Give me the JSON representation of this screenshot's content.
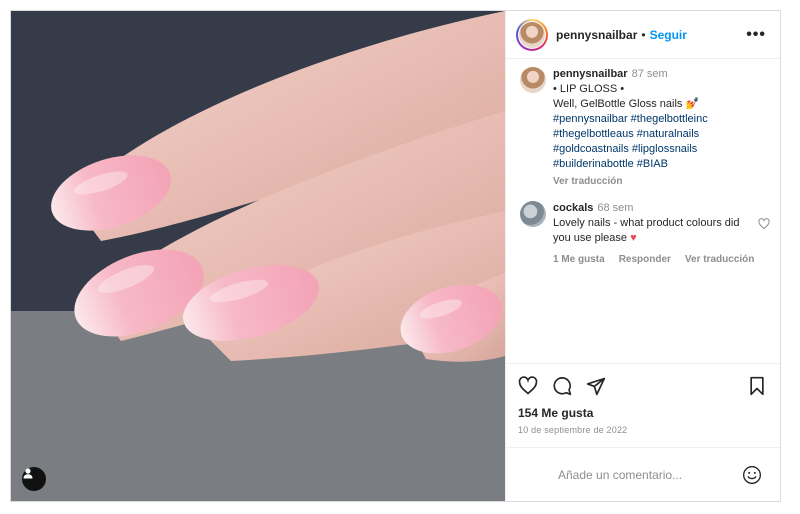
{
  "post": {
    "author": {
      "username": "pennysnailbar",
      "separator": "•",
      "follow_label": "Seguir",
      "more_icon": "more-horizontal-icon"
    },
    "caption": {
      "username": "pennysnailbar",
      "time": "87 sem",
      "line1": "• LIP GLOSS •",
      "line2": "Well, GelBottle Gloss nails 💅",
      "hashtags": [
        "#pennysnailbar #thegelbottleinc",
        "#thegelbottleaus #naturalnails",
        "#goldcoastnails #lipglossnails",
        "#builderinabottle #BIAB"
      ],
      "translate_label": "Ver traducción"
    },
    "comments": [
      {
        "username": "cockals",
        "time": "68 sem",
        "text": "Lovely nails - what product colours did you use please",
        "emoji": "❤️",
        "likes_label": "1 Me gusta",
        "reply_label": "Responder",
        "translate_label": "Ver traducción"
      }
    ],
    "likes_text": "154 Me gusta",
    "date_text": "10 de septiembre de 2022",
    "add_comment_placeholder": "Añade un comentario...",
    "icons": [
      "heart-icon",
      "comment-icon",
      "share-icon",
      "bookmark-icon",
      "emoji-icon",
      "user-tag-icon"
    ],
    "colors": {
      "follow_blue": "#0095f6",
      "hashtag_blue": "#00376b",
      "heart_red": "#ed4956",
      "nail_pink": "#f6b5c4"
    }
  }
}
